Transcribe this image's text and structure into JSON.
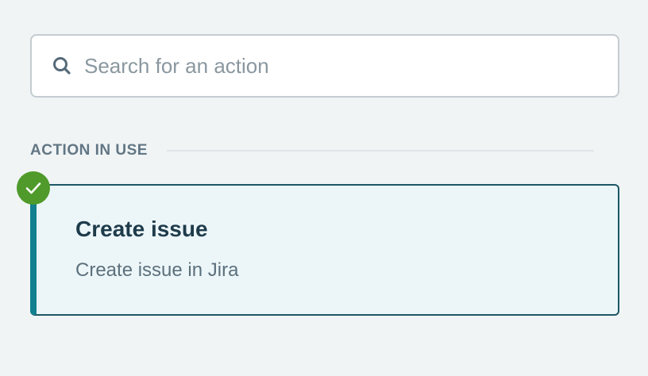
{
  "search": {
    "placeholder": "Search for an action",
    "value": "",
    "icon": "search-icon"
  },
  "section": {
    "title": "ACTION IN USE"
  },
  "action": {
    "title": "Create issue",
    "description": "Create issue in Jira",
    "status_icon": "check-circle-icon",
    "colors": {
      "accent": "#12808f",
      "border": "#1c5766",
      "background": "#ecf6f9",
      "status": "#4f9a2a"
    }
  }
}
